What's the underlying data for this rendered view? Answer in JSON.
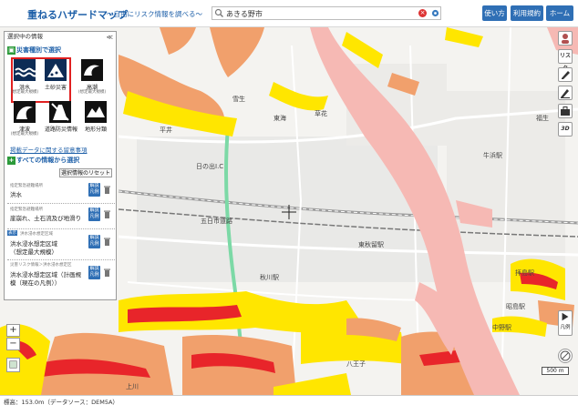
{
  "header": {
    "title": "重ねるハザードマップ",
    "subtitle": "～自由にリスク情報を調べる～",
    "search_value": "あきる野市",
    "buttons": {
      "howto": "使い方",
      "terms": "利用規約",
      "home": "ホーム"
    }
  },
  "panel": {
    "title": "選択中の情報",
    "collapse_symbol": "≪",
    "disaster_section": "災害種別で選択",
    "disasters": [
      {
        "label": "洪水",
        "sub": "(想定最大規模)"
      },
      {
        "label": "土砂災害",
        "sub": ""
      },
      {
        "label": "高潮",
        "sub": "(想定最大規模)"
      },
      {
        "label": "津波",
        "sub": "(想定最大規模)"
      },
      {
        "label": "道路防災情報",
        "sub": ""
      },
      {
        "label": "地形分類",
        "sub": ""
      }
    ],
    "notice_link": "掲載データに関する留意事項",
    "all_info_section": "すべての情報から選択",
    "reset_label": "選択情報のリセット",
    "legend_label": [
      "解説",
      "凡例"
    ],
    "layers": [
      {
        "category": "指定緊急避難場所",
        "name": "洪水",
        "badge": ""
      },
      {
        "category": "指定緊急避難場所",
        "name": "崖崩れ、土石流及び地滑り",
        "badge": ""
      },
      {
        "category": "洪水浸水想定区域",
        "name": "洪水浸水想定区域",
        "name2": "（想定最大規模）",
        "badge": "表示"
      },
      {
        "category": "災害リスク情報＞洪水浸水想定区",
        "name": "洪水浸水想定区域（計画規",
        "name2": "模（現在の凡例））",
        "badge": ""
      }
    ]
  },
  "map_labels": [
    {
      "text": "雪生",
      "cls": "l1"
    },
    {
      "text": "平井",
      "cls": "l2"
    },
    {
      "text": "日の出I.C",
      "cls": "l3"
    },
    {
      "text": "五日市道路",
      "cls": "l4"
    },
    {
      "text": "東秋留駅",
      "cls": "l5"
    },
    {
      "text": "秋川駅",
      "cls": "l6"
    },
    {
      "text": "拝島駅",
      "cls": "l7"
    },
    {
      "text": "昭島駅",
      "cls": "l8"
    },
    {
      "text": "牛浜駅",
      "cls": "l9"
    },
    {
      "text": "福生",
      "cls": "l10"
    },
    {
      "text": "東海",
      "cls": "l11"
    },
    {
      "text": "草花",
      "cls": "l12"
    },
    {
      "text": "上川",
      "cls": "l13"
    },
    {
      "text": "八王子",
      "cls": "l14"
    },
    {
      "text": "中野駅",
      "cls": "l15"
    }
  ],
  "right_tools": [
    "avatar",
    "リスク",
    "pencil",
    "pen",
    "bag",
    "3D"
  ],
  "legend_button": "凡例",
  "scale": "500 m",
  "zoom": {
    "in": "+",
    "out": "−"
  },
  "footer": "標高：153.0m（データソース：DEM5A）",
  "colors": {
    "brand": "#1d5fa8",
    "button": "#2f6fb5",
    "flood_pink": "#f6b9b4",
    "landslide_yellow": "#ffe600",
    "landslide_orange": "#f1a06c",
    "landslide_red": "#e8252a",
    "road_green": "#7cd9a6",
    "panel_green": "#2c9a3a"
  }
}
